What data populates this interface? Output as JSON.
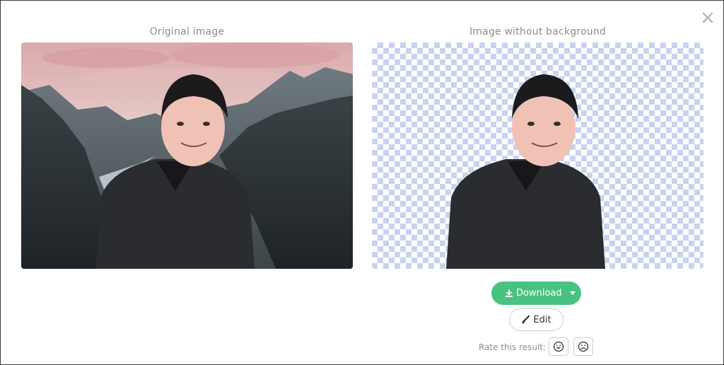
{
  "original": {
    "title": "Original image"
  },
  "result": {
    "title": "Image without background"
  },
  "actions": {
    "download_label": "Download",
    "edit_label": "Edit"
  },
  "rating": {
    "label": "Rate this result:"
  },
  "icons": {
    "close": "close-icon",
    "download": "download-icon",
    "caret": "chevron-down-icon",
    "edit": "brush-icon",
    "happy": "smile-icon",
    "sad": "frown-icon"
  },
  "colors": {
    "accent": "#48c281",
    "checker": "#c8d4ee",
    "muted_text": "#8d8d8d"
  }
}
